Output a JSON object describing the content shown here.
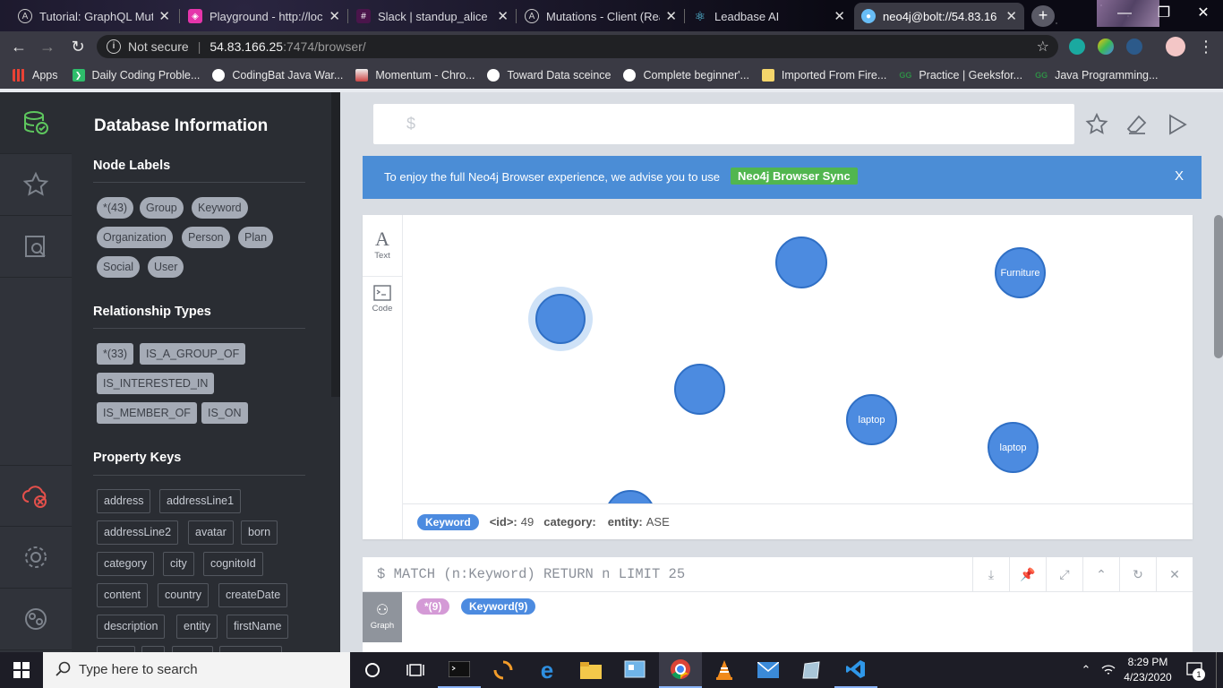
{
  "browser": {
    "tabs": [
      {
        "title": "Tutorial: GraphQL Muta",
        "icon": "apollo-icon",
        "color": "#ffffff"
      },
      {
        "title": "Playground - http://loc",
        "icon": "graphql-icon",
        "color": "#e535ab"
      },
      {
        "title": "Slack | standup_alice | I",
        "icon": "slack-icon",
        "color": "#4a154b"
      },
      {
        "title": "Mutations - Client (Rea",
        "icon": "apollo-icon",
        "color": "#ffffff"
      },
      {
        "title": "Leadbase AI",
        "icon": "react-icon",
        "color": "#61dafb"
      },
      {
        "title": "neo4j@bolt://54.83.16",
        "icon": "neo4j-icon",
        "color": "#68bdf6"
      }
    ],
    "new_tab": "+",
    "address": {
      "security": "Not secure",
      "host": "54.83.166.25",
      "path": ":7474/browser/"
    },
    "bookmarks": [
      {
        "label": "Apps",
        "icon": "apps-grid-icon"
      },
      {
        "label": "Daily Coding Proble...",
        "icon": "bookmark-green-icon"
      },
      {
        "label": "CodingBat Java War...",
        "icon": "globe-icon"
      },
      {
        "label": "Momentum - Chro...",
        "icon": "momentum-icon"
      },
      {
        "label": "Toward Data sceince",
        "icon": "globe-icon"
      },
      {
        "label": "Complete beginner'...",
        "icon": "globe-icon"
      },
      {
        "label": "Imported From Fire...",
        "icon": "folder-icon"
      },
      {
        "label": "Practice | Geeksfor...",
        "icon": "gfg-icon"
      },
      {
        "label": "Java Programming...",
        "icon": "gfg-icon"
      }
    ]
  },
  "drawer": {
    "title": "Database Information",
    "node_labels_heading": "Node Labels",
    "node_labels": [
      "*(43)",
      "Group",
      "Keyword",
      "Organization",
      "Person",
      "Plan",
      "Social",
      "User"
    ],
    "relationship_types_heading": "Relationship Types",
    "relationship_types": [
      "*(33)",
      "IS_A_GROUP_OF",
      "IS_INTERESTED_IN",
      "IS_MEMBER_OF",
      "IS_ON"
    ],
    "property_keys_heading": "Property Keys",
    "property_keys": [
      "address",
      "addressLine1",
      "addressLine2",
      "avatar",
      "born",
      "category",
      "city",
      "cognitoId",
      "content",
      "country",
      "createDate",
      "description",
      "entity",
      "firstName"
    ]
  },
  "editor": {
    "prompt": "$"
  },
  "banner": {
    "message": "To enjoy the full Neo4j Browser experience, we advise you to use",
    "link": "Neo4j Browser Sync",
    "close": "X"
  },
  "result_frame": {
    "side_buttons": [
      {
        "label": "Text",
        "glyph": "A"
      },
      {
        "label": "Code"
      }
    ],
    "nodes": [
      {
        "caption": ""
      },
      {
        "caption": ""
      },
      {
        "caption": "Furniture"
      },
      {
        "caption": ""
      },
      {
        "caption": "laptop"
      },
      {
        "caption": "laptop"
      },
      {
        "caption": ""
      }
    ],
    "inspector": {
      "label": "Keyword",
      "id_key": "<id>:",
      "id_value": "49",
      "category_key": "category:",
      "entity_key": "entity:",
      "entity_value": "ASE"
    }
  },
  "second_frame": {
    "query": "$ MATCH (n:Keyword) RETURN n LIMIT 25",
    "view_label": "Graph",
    "tag_all": "*(9)",
    "tag_keyword": "Keyword(9)"
  },
  "taskbar": {
    "search_placeholder": "Type here to search",
    "time": "8:29 PM",
    "date": "4/23/2020",
    "notification_count": "1"
  }
}
